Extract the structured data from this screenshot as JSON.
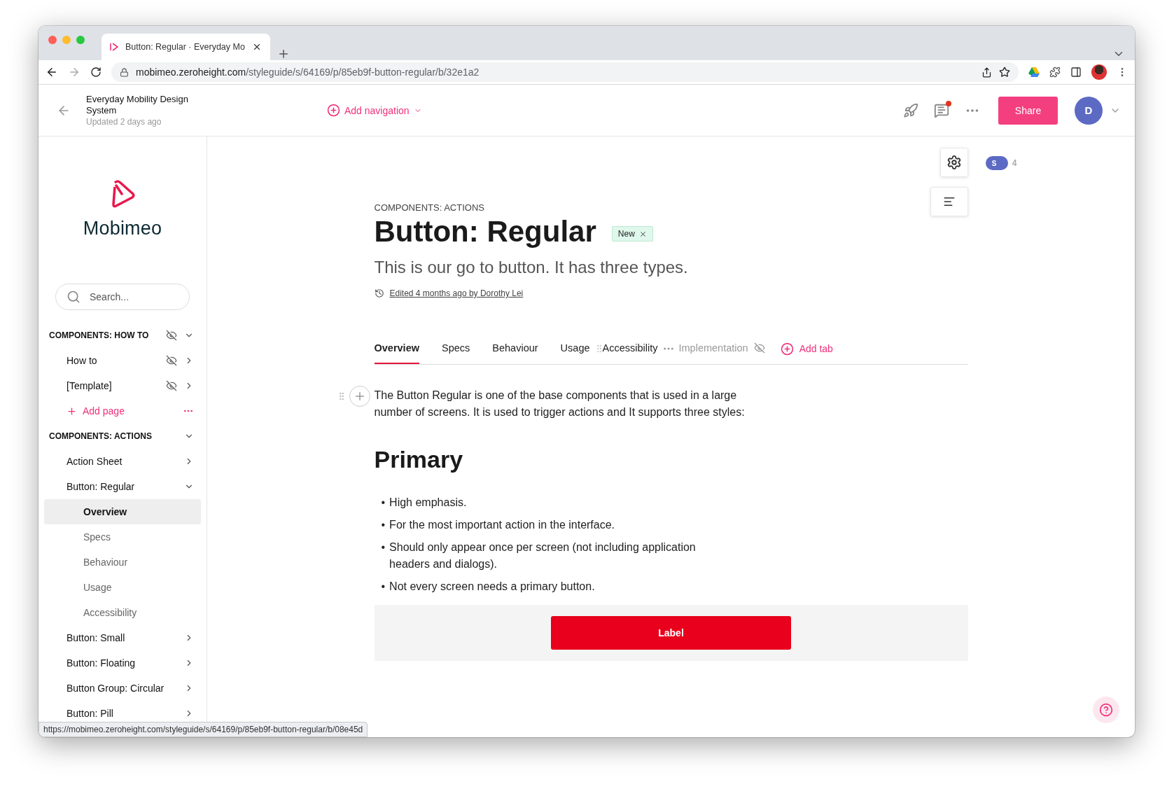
{
  "browser": {
    "tab_title": "Button: Regular  · Everyday Mo",
    "url_host": "mobimeo.zeroheight.com",
    "url_path": "/styleguide/s/64169/p/85eb9f-button-regular/b/32e1a2",
    "status_url": "https://mobimeo.zeroheight.com/styleguide/s/64169/p/85eb9f-button-regular/b/08e45d"
  },
  "header": {
    "title": "Everyday Mobility Design System",
    "updated": "Updated 2 days ago",
    "add_navigation": "Add navigation",
    "unread_comments": true,
    "share": "Share",
    "avatar": "D"
  },
  "sidebar": {
    "logo": "Mobimeo",
    "search_placeholder": "Search...",
    "sections": [
      {
        "title": "COMPONENTS: HOW TO",
        "hidden": true,
        "expanded": true,
        "items": [
          {
            "kind": "page",
            "label": "How to",
            "hidden": true,
            "expanded": false
          },
          {
            "kind": "page",
            "label": "[Template]",
            "hidden": true,
            "expanded": false
          },
          {
            "kind": "add",
            "label": "Add page"
          }
        ]
      },
      {
        "title": "COMPONENTS: ACTIONS",
        "hidden": false,
        "expanded": true,
        "items": [
          {
            "kind": "page",
            "label": "Action Sheet",
            "hidden": false,
            "expanded": false
          },
          {
            "kind": "page",
            "label": "Button: Regular",
            "hidden": false,
            "expanded": true,
            "children": [
              {
                "label": "Overview",
                "selected": true
              },
              {
                "label": "Specs",
                "selected": false
              },
              {
                "label": "Behaviour",
                "selected": false
              },
              {
                "label": "Usage",
                "selected": false
              },
              {
                "label": "Accessibility",
                "selected": false
              }
            ]
          },
          {
            "kind": "page",
            "label": "Button: Small",
            "hidden": false,
            "expanded": false
          },
          {
            "kind": "page",
            "label": "Button: Floating",
            "hidden": false,
            "expanded": false
          },
          {
            "kind": "page",
            "label": "Button Group: Circular",
            "hidden": false,
            "expanded": false
          },
          {
            "kind": "page",
            "label": "Button: Pill",
            "hidden": false,
            "expanded": false
          }
        ]
      }
    ]
  },
  "page": {
    "presence_avatar": "S",
    "presence_count": "4",
    "category": "COMPONENTS: ACTIONS",
    "title": "Button: Regular",
    "badge": "New",
    "subtitle": "This is our go to button. It has three types.",
    "edited": "Edited 4 months ago by Dorothy Lei",
    "tabs": [
      {
        "label": "Overview",
        "selected": true,
        "hidden": false
      },
      {
        "label": "Specs",
        "selected": false,
        "hidden": false
      },
      {
        "label": "Behaviour",
        "selected": false,
        "hidden": false
      },
      {
        "label": "Usage",
        "selected": false,
        "hidden": false
      },
      {
        "label": "Accessibility",
        "selected": false,
        "hidden": false
      },
      {
        "label": "Implementation",
        "selected": false,
        "hidden": true
      }
    ],
    "add_tab": "Add tab",
    "intro": "The Button Regular is one of the base components that is used in a large number of screens. It is used to trigger actions and It supports three styles:",
    "heading": "Primary",
    "bullet_marker": "•",
    "bullets": [
      "High emphasis.",
      "For the most important action in the interface.",
      "Should only appear once per screen (not including application headers and dialogs).",
      "Not every screen needs a primary button."
    ],
    "preview_button": "Label"
  }
}
